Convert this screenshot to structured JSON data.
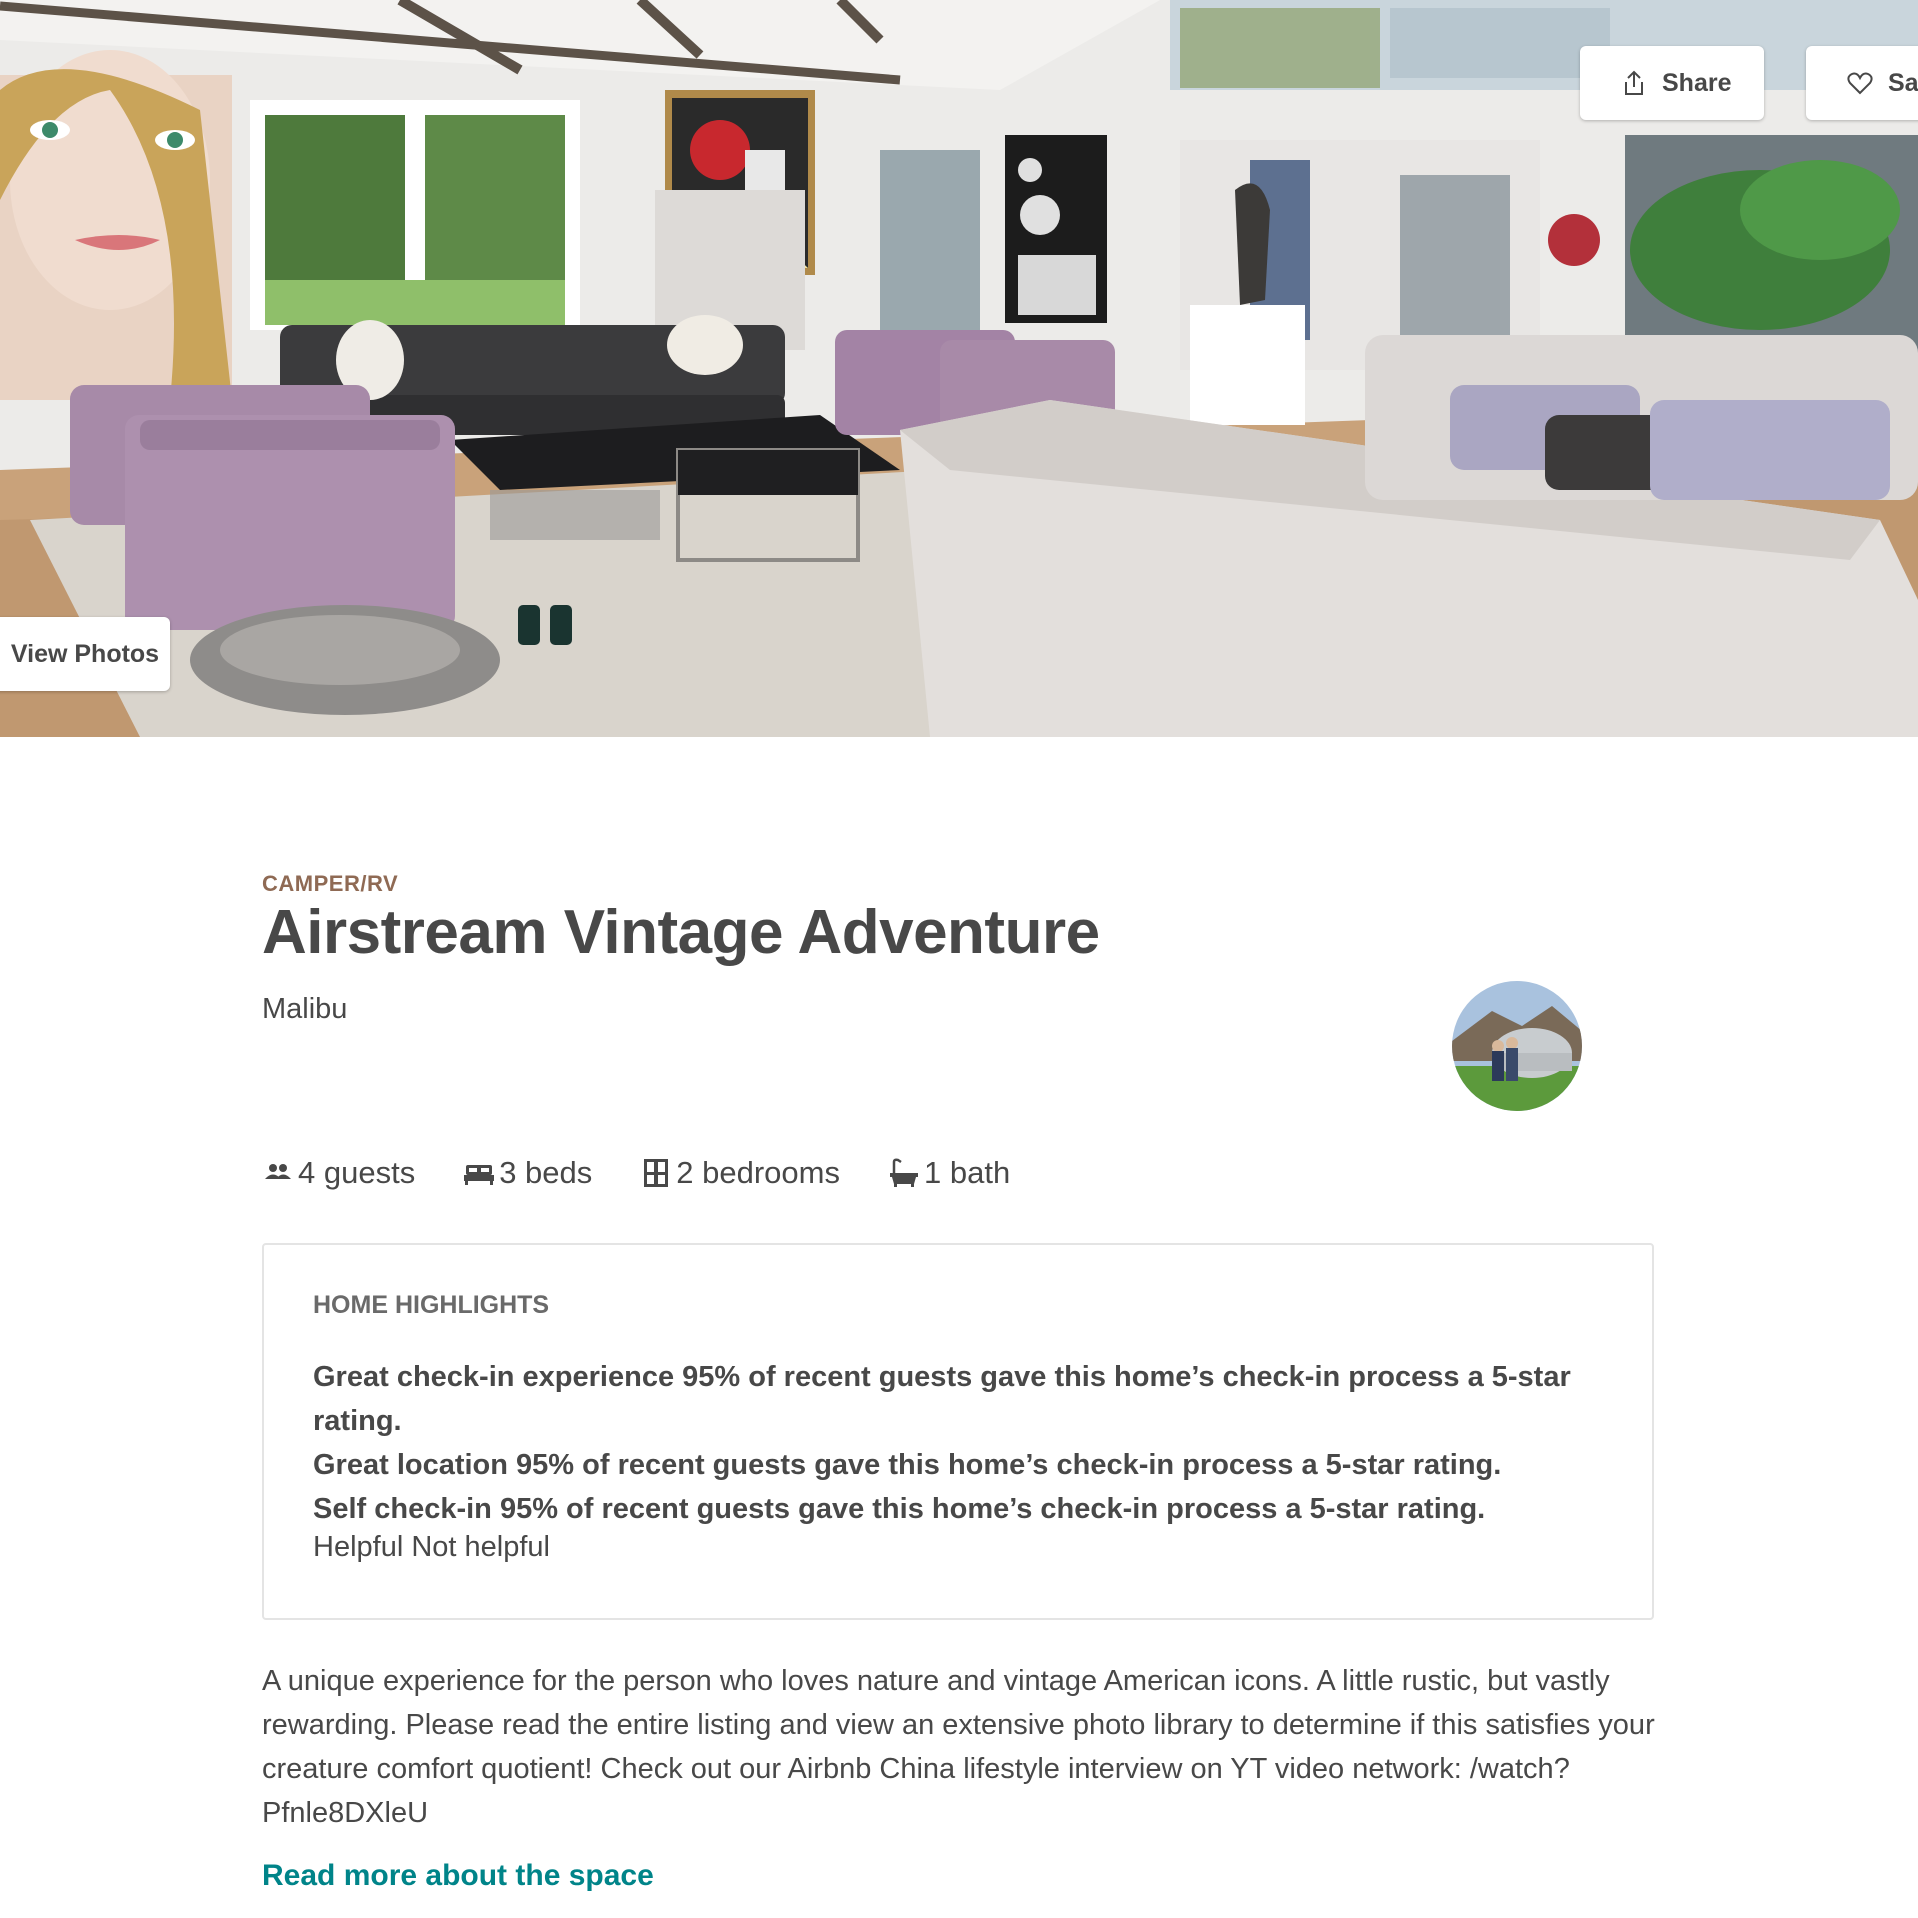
{
  "hero": {
    "share_label": "Share",
    "save_label": "Save",
    "view_photos_label": "View Photos"
  },
  "listing": {
    "category": "CAMPER/RV",
    "title": "Airstream Vintage Adventure",
    "location": "Malibu",
    "facts": {
      "guests": "4 guests",
      "beds": "3 beds",
      "bedrooms": "2 bedrooms",
      "baths": "1 bath"
    }
  },
  "highlights": {
    "heading": "HOME HIGHLIGHTS",
    "items": [
      "Great check-in experience 95% of recent guests gave this home’s check-in process a 5-star rating.",
      "Great location 95% of recent guests gave this home’s check-in process a 5-star rating.",
      "Self check-in 95% of recent guests gave this home’s check-in process a 5-star rating."
    ],
    "helpful_label": "Helpful",
    "not_helpful_label": "Not helpful"
  },
  "description": "A unique experience for the person who loves nature and vintage American icons. A little rustic, but vastly rewarding. Please read the entire listing and view an extensive photo library to determine if this satisfies your creature comfort quotient! Check out our Airbnb China lifestyle interview on YT video network: /watch?Pfnle8DXleU",
  "read_more_label": "Read more about the space",
  "colors": {
    "kicker": "#8f6a54",
    "text": "#484848",
    "link": "#008489",
    "border": "#e4e4e4"
  }
}
